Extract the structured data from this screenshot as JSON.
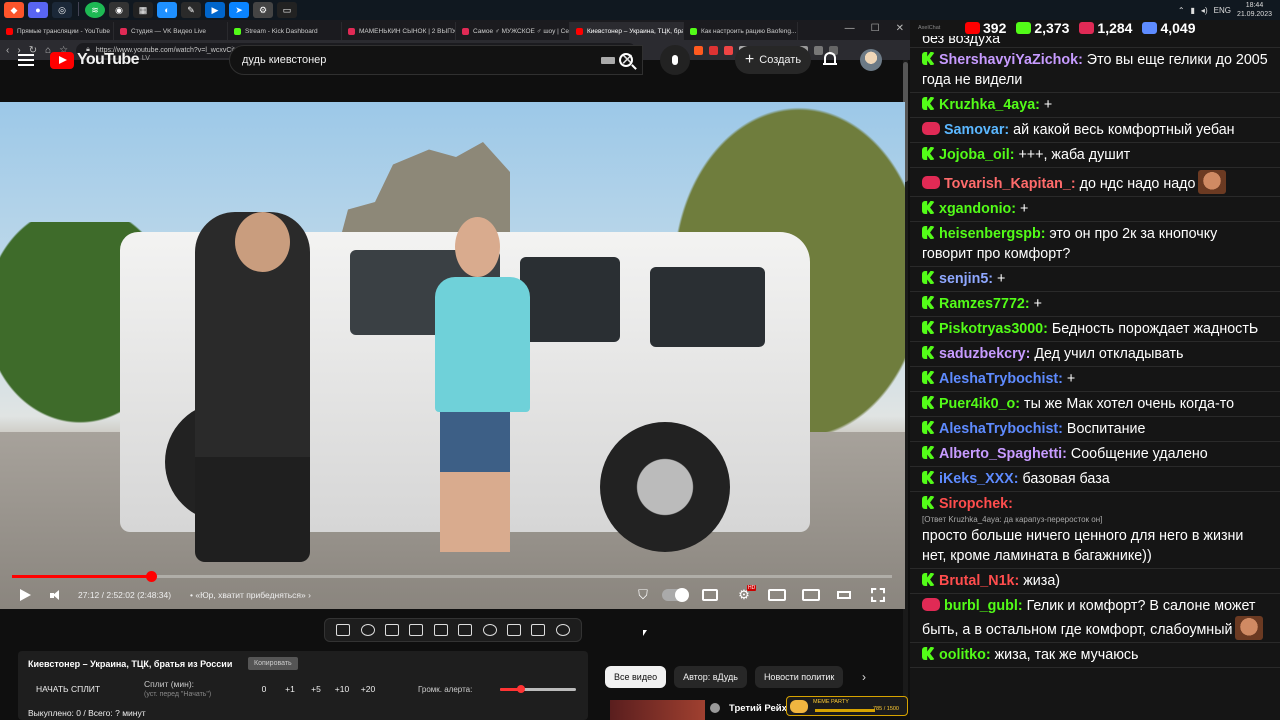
{
  "taskbar": {
    "lang": "ENG",
    "time": "18:44",
    "date": "21.09.2023"
  },
  "browser": {
    "tabs": [
      {
        "label": "Прямые трансляции - YouTube",
        "color": "#ff0000"
      },
      {
        "label": "Студия — VK Видео Live",
        "color": "#e02a55"
      },
      {
        "label": "Stream - Kick Dashboard",
        "color": "#53fc18"
      },
      {
        "label": "МАМЕНЬКИН СЫНОК | 2 ВЫПУСК",
        "color": "#e02a55"
      },
      {
        "label": "Самое ♂ МУЖСКОЕ ♂ шоу | Сезон",
        "color": "#e02a55"
      },
      {
        "label": "Киевстонер – Украина, ТЦК, бра",
        "color": "#ff0000"
      },
      {
        "label": "Как настроить рацию Baofeng...",
        "color": "#53fc18"
      }
    ],
    "active_tab": 5,
    "url": "https://www.youtube.com/watch?v=l_wcxvCjU6c&t=5424s"
  },
  "youtube": {
    "logo_text": "YouTube",
    "logo_region": "LV",
    "search_value": "дудь киевстонер",
    "create_label": "Создать"
  },
  "player": {
    "time": "27:12 / 2:52:02 (2:48:34)",
    "chapter": "• «Юр, хватит прибедняться»",
    "chapter_arrow": "›",
    "progress": 0.158,
    "hd_badge": "HD"
  },
  "split": {
    "title": "Киевстонер – Украина, ТЦК, братья из России",
    "copy_label": "Копировать",
    "start_label": "НАЧАТЬ СПЛИТ",
    "min_label": "Сплит (мин):",
    "hint": "(уст. перед \"Начать\")",
    "values": [
      "0",
      "+1",
      "+5",
      "+10",
      "+20"
    ],
    "alert_label": "Громк. алерта:",
    "alert_level": 0.27,
    "bought": "Выкуплено: 0 / Всего: ? минут"
  },
  "chips": [
    "Все видео",
    "Автор: вДудь",
    "Новости политик"
  ],
  "chip_next": "›",
  "recommend": {
    "title": "Третий Рейх"
  },
  "meme_badge": {
    "title": "MEME PARTY",
    "progress_text": "785 / 1500"
  },
  "chat": {
    "app_name": "AxelChat",
    "stats": [
      {
        "value": "392",
        "color": "#ff0000"
      },
      {
        "value": "2,373",
        "color": "#53fc18"
      },
      {
        "value": "1,284",
        "color": "#e02a55"
      },
      {
        "value": "4,049",
        "color": "#5e8bff"
      }
    ],
    "top_cut": "без воздуха",
    "messages": [
      {
        "platform": "kick",
        "nick": "ShershavyiYaZichok:",
        "color": "#c79bff",
        "text": " Это вы еще гелики до 2005 года не видели"
      },
      {
        "platform": "kick",
        "nick": "Kruzhka_4aya:",
        "color": "#53fc18",
        "text": " +"
      },
      {
        "platform": "live",
        "nick": "Samovar:",
        "color": "#5bb7ff",
        "text": " ай какой весь комфортный уебан"
      },
      {
        "platform": "kick",
        "nick": "Jojoba_oil:",
        "color": "#53fc18",
        "text": " +++, жаба душит"
      },
      {
        "platform": "live",
        "nick": "Tovarish_Kapitan_:",
        "color": "#ff6b6b",
        "text": " до ндс надо надо",
        "emote": true
      },
      {
        "platform": "kick",
        "nick": "xgandonio:",
        "color": "#53fc18",
        "text": " +"
      },
      {
        "platform": "kick",
        "nick": "heisenbergspb:",
        "color": "#53fc18",
        "text": " это он про 2к за кнопочку говорит про комфорт?"
      },
      {
        "platform": "kick",
        "nick": "senjin5:",
        "color": "#8fa8ff",
        "text": " +"
      },
      {
        "platform": "kick",
        "nick": "Ramzes7772:",
        "color": "#53fc18",
        "text": " +"
      },
      {
        "platform": "kick",
        "nick": "Piskotryas3000:",
        "color": "#53fc18",
        "text": " Бедность порождает жадностЬ"
      },
      {
        "platform": "kick",
        "nick": "saduzbekcry:",
        "color": "#c79bff",
        "text": " Дед учил откладывать"
      },
      {
        "platform": "kick",
        "nick": "AleshaTrybochist:",
        "color": "#5e8bff",
        "text": " +"
      },
      {
        "platform": "kick",
        "nick": "Puer4ik0_o:",
        "color": "#53fc18",
        "text": " ты же Мак хотел очень когда-то"
      },
      {
        "platform": "kick",
        "nick": "AleshaTrybochist:",
        "color": "#5e8bff",
        "text": " Воспитание"
      },
      {
        "platform": "kick",
        "nick": "Alberto_Spaghetti:",
        "color": "#c79bff",
        "text": " Сообщение удалено"
      },
      {
        "platform": "kick",
        "nick": "iKeks_XXX:",
        "color": "#5e8bff",
        "text": " базовая база"
      },
      {
        "platform": "kick",
        "nick": "Siropchek:",
        "color": "#ff4d4d",
        "text": "",
        "reply": "[Ответ Kruzhka_4aya: да карапуз-переросток он]",
        "text2": "просто больше ничего ценного для него в жизни нет, кроме ламината в багажнике))"
      },
      {
        "platform": "kick",
        "nick": "Brutal_N1k:",
        "color": "#ff4d4d",
        "text": " жиза)"
      },
      {
        "platform": "live",
        "nick": "burbl_gubl:",
        "color": "#53fc18",
        "text": " Гелик и комфорт? В салоне может быть, а в остальном где комфорт, слабоумный",
        "emote": true
      },
      {
        "platform": "kick",
        "nick": "oolitko:",
        "color": "#53fc18",
        "text": " жиза, так же мучаюсь"
      }
    ]
  }
}
